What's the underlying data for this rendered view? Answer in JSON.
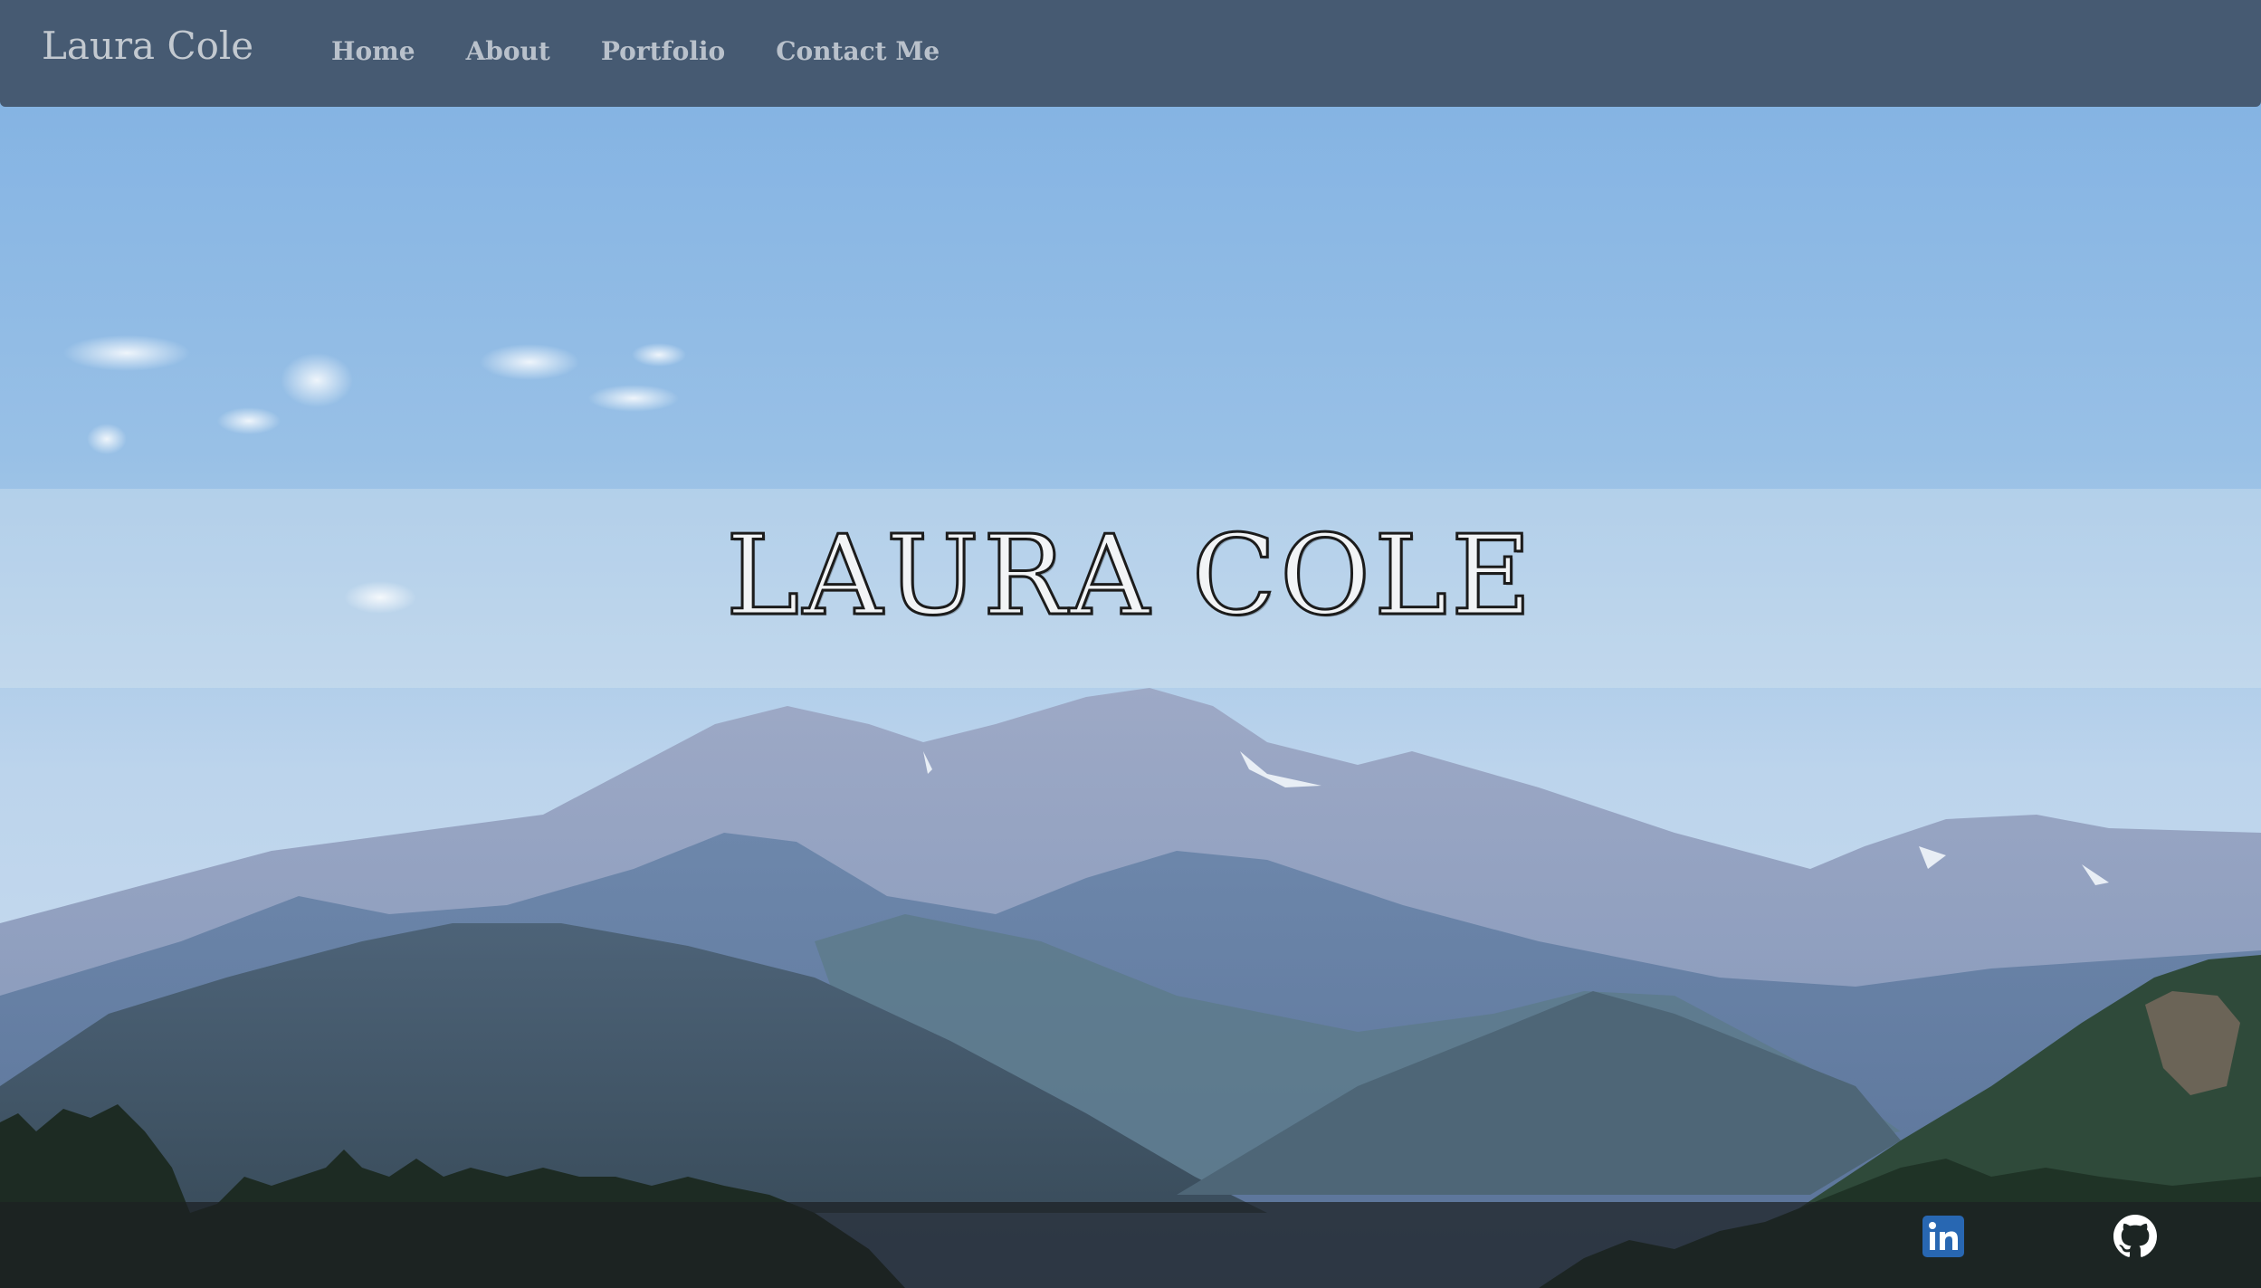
{
  "navbar": {
    "brand": "Laura Cole",
    "links": [
      {
        "label": "Home"
      },
      {
        "label": "About"
      },
      {
        "label": "Portfolio"
      },
      {
        "label": "Contact Me"
      }
    ]
  },
  "hero": {
    "title": "LAURA COLE"
  },
  "footer": {
    "social": [
      {
        "icon": "linkedin-icon",
        "color": "#2867b2"
      },
      {
        "icon": "github-icon",
        "color": "#ffffff"
      }
    ]
  },
  "colors": {
    "navbar_bg": "#465a72",
    "nav_text": "#b9c1cb",
    "sky": "#86b3e0",
    "footer_bg": "#1c2022"
  }
}
